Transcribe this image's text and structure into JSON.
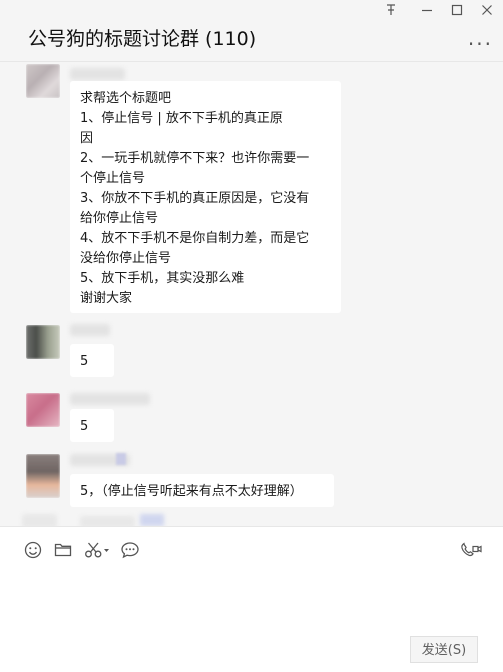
{
  "window": {
    "title": "公号狗的标题讨论群 (110)",
    "pin_icon": "pin-icon",
    "minimize_icon": "minimize-icon",
    "maximize_icon": "maximize-icon",
    "close_icon": "close-icon",
    "more_label": "..."
  },
  "messages": [
    {
      "lines": [
        "求帮选个标题吧",
        "1、停止信号   |    放不下手机的真正原",
        "因",
        "2、一玩手机就停不下来？也许你需要一",
        "个停止信号",
        "3、你放不下手机的真正原因是，它没有",
        "给你停止信号",
        "4、放不下手机不是你自制力差，而是它",
        "没给你停止信号",
        "5、放下手机，其实没那么难",
        "谢谢大家"
      ]
    },
    {
      "lines": [
        "5"
      ]
    },
    {
      "lines": [
        "5"
      ]
    },
    {
      "lines": [
        "5，（停止信号听起来有点不太好理解）"
      ]
    }
  ],
  "toolbar": {
    "emoji_icon": "emoji-icon",
    "folder_icon": "folder-icon",
    "scissors_icon": "scissors-icon",
    "chat_history_icon": "chat-history-icon",
    "video_call_icon": "video-call-icon"
  },
  "send_label": "发送(S)"
}
